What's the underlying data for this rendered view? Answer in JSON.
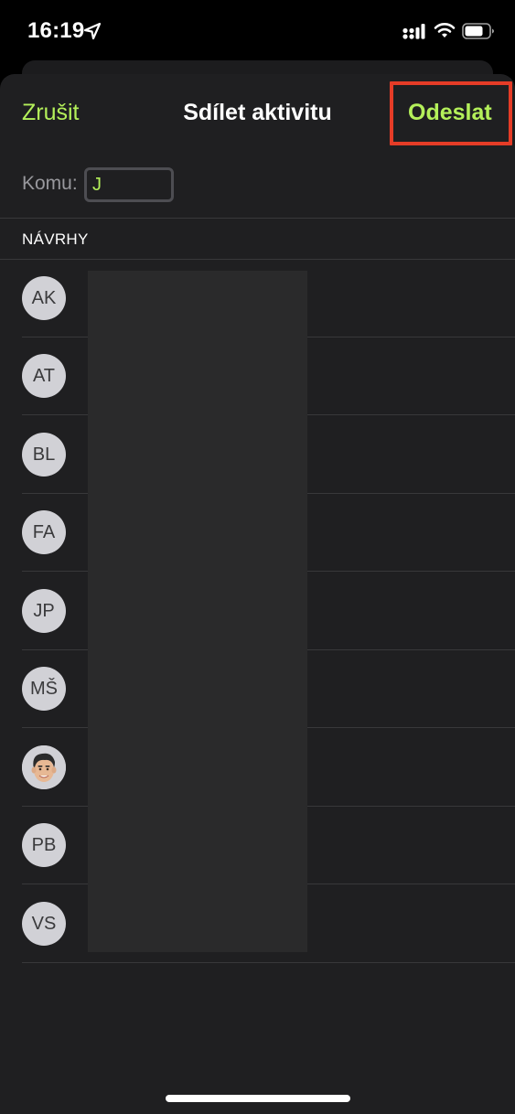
{
  "status_bar": {
    "time": "16:19",
    "icons": [
      "location-arrow-icon",
      "signal-icon",
      "wifi-icon",
      "battery-icon"
    ]
  },
  "nav": {
    "cancel_label": "Zrušit",
    "title": "Sdílet aktivitu",
    "send_label": "Odeslat"
  },
  "recipient": {
    "label": "Komu:",
    "value": "J"
  },
  "suggestions": {
    "header": "NÁVRHY",
    "contacts": [
      {
        "initials": "AK"
      },
      {
        "initials": "AT"
      },
      {
        "initials": "BL"
      },
      {
        "initials": "FA"
      },
      {
        "initials": "JP"
      },
      {
        "initials": "MŠ"
      },
      {
        "initials": "",
        "avatar_icon": "memoji-avatar-icon"
      },
      {
        "initials": "PB"
      },
      {
        "initials": "VS"
      }
    ]
  },
  "colors": {
    "accent": "#b4f05a",
    "highlight": "#e53c27",
    "sheet_background": "#1f1f21",
    "avatar_background": "#d1d1d6"
  }
}
